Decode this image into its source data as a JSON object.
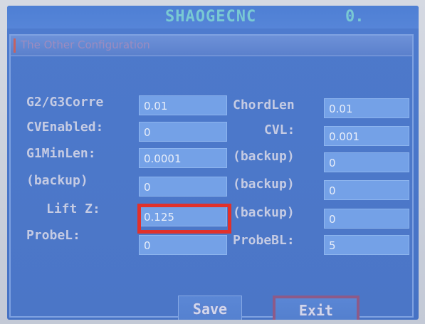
{
  "header": {
    "brand": "SHAOGECNC",
    "status_value": "0."
  },
  "panel": {
    "title": "The Other Configuration"
  },
  "fields_left": [
    {
      "label": "G2/G3Corre",
      "value": "0.01"
    },
    {
      "label": "CVEnabled:",
      "value": "0"
    },
    {
      "label": "G1MinLen:",
      "value": "0.0001"
    },
    {
      "label": "(backup)",
      "value": "0"
    },
    {
      "label": "Lift Z:",
      "value": "0.125"
    },
    {
      "label": "ProbeL:",
      "value": "0"
    }
  ],
  "fields_right": [
    {
      "label": "ChordLen",
      "value": "0.01"
    },
    {
      "label": "CVL:",
      "value": "0.001"
    },
    {
      "label": "(backup)",
      "value": "0"
    },
    {
      "label": "(backup)",
      "value": "0"
    },
    {
      "label": "(backup)",
      "value": "0"
    },
    {
      "label": "ProbeBL:",
      "value": "5"
    }
  ],
  "buttons": {
    "save_label": "Save",
    "exit_label": "Exit"
  },
  "colors": {
    "highlight": "#e1312b",
    "screen_blue": "#4a77ca",
    "field_blue": "#74a1e7"
  }
}
